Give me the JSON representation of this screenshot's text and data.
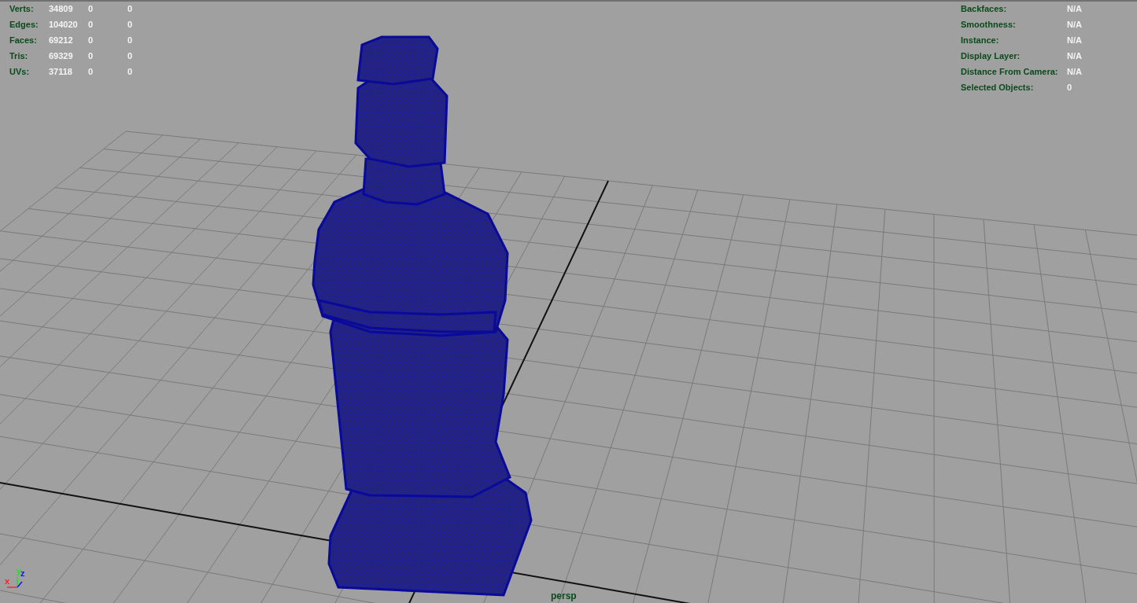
{
  "hud_left": {
    "rows": [
      {
        "label": "Verts:",
        "values": [
          "34809",
          "0",
          "0"
        ]
      },
      {
        "label": "Edges:",
        "values": [
          "104020",
          "0",
          "0"
        ]
      },
      {
        "label": "Faces:",
        "values": [
          "69212",
          "0",
          "0"
        ]
      },
      {
        "label": "Tris:",
        "values": [
          "69329",
          "0",
          "0"
        ]
      },
      {
        "label": "UVs:",
        "values": [
          "37118",
          "0",
          "0"
        ]
      }
    ]
  },
  "hud_right": {
    "rows": [
      {
        "label": "Backfaces:",
        "value": "N/A"
      },
      {
        "label": "Smoothness:",
        "value": "N/A"
      },
      {
        "label": "Instance:",
        "value": "N/A"
      },
      {
        "label": "Display Layer:",
        "value": "N/A"
      },
      {
        "label": "Distance From Camera:",
        "value": "N/A"
      },
      {
        "label": "Selected Objects:",
        "value": "0"
      }
    ]
  },
  "axis_gizmo": {
    "labels": [
      {
        "text": "x",
        "color": "#ff2020"
      },
      {
        "text": "y",
        "color": "#20e020"
      },
      {
        "text": "z",
        "color": "#1010ff"
      }
    ]
  },
  "camera_label": "persp"
}
